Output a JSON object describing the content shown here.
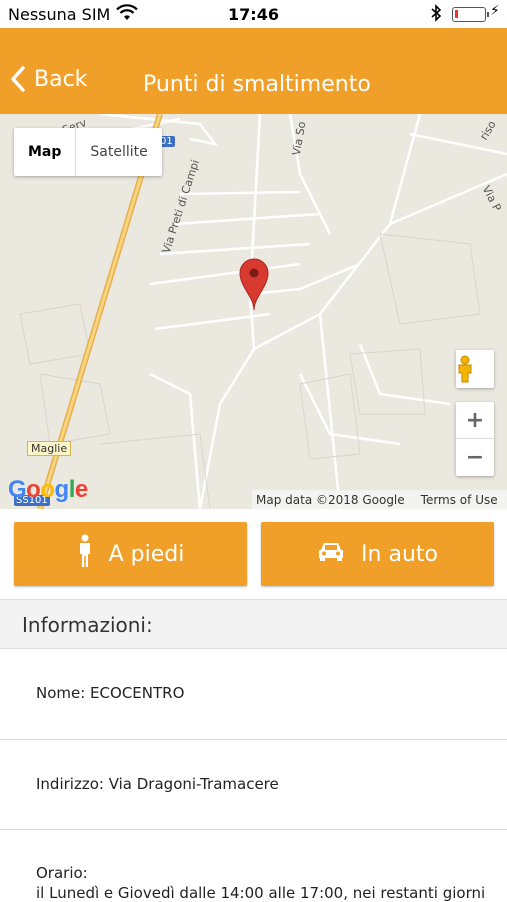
{
  "status_bar": {
    "carrier": "Nessuna SIM",
    "time": "17:46",
    "battery_level": 0.1,
    "icons": [
      "wifi-icon",
      "bluetooth-icon",
      "battery-icon",
      "charging-icon"
    ]
  },
  "nav": {
    "back_label": "Back",
    "title": "Punti di smaltimento",
    "color": "#f0a028"
  },
  "map": {
    "type_options": [
      "Map",
      "Satellite"
    ],
    "selected_type": "Map",
    "zoom_in": "+",
    "zoom_out": "−",
    "attribution": "Map data ©2018 Google",
    "terms": "Terms of Use",
    "logo": "Google",
    "labels": {
      "via_preti": "Via Preti di Campi",
      "via_so": "Via So",
      "maglie": "Maglie",
      "road_01": "01",
      "road_ss": "SS101",
      "serv": "Serv",
      "via_p": "Via P",
      "riso": "riso"
    },
    "marker_color": "#d93a2f"
  },
  "actions": {
    "walk_label": "A piedi",
    "car_label": "In auto"
  },
  "info": {
    "header": "Informazioni:",
    "name": "Nome: ECOCENTRO",
    "address": "Indirizzo: Via Dragoni-Tramacere",
    "hours_label": "Orario:",
    "hours_text": "il Lunedì e Giovedì dalle 14:00 alle 17:00, nei restanti giorni"
  }
}
